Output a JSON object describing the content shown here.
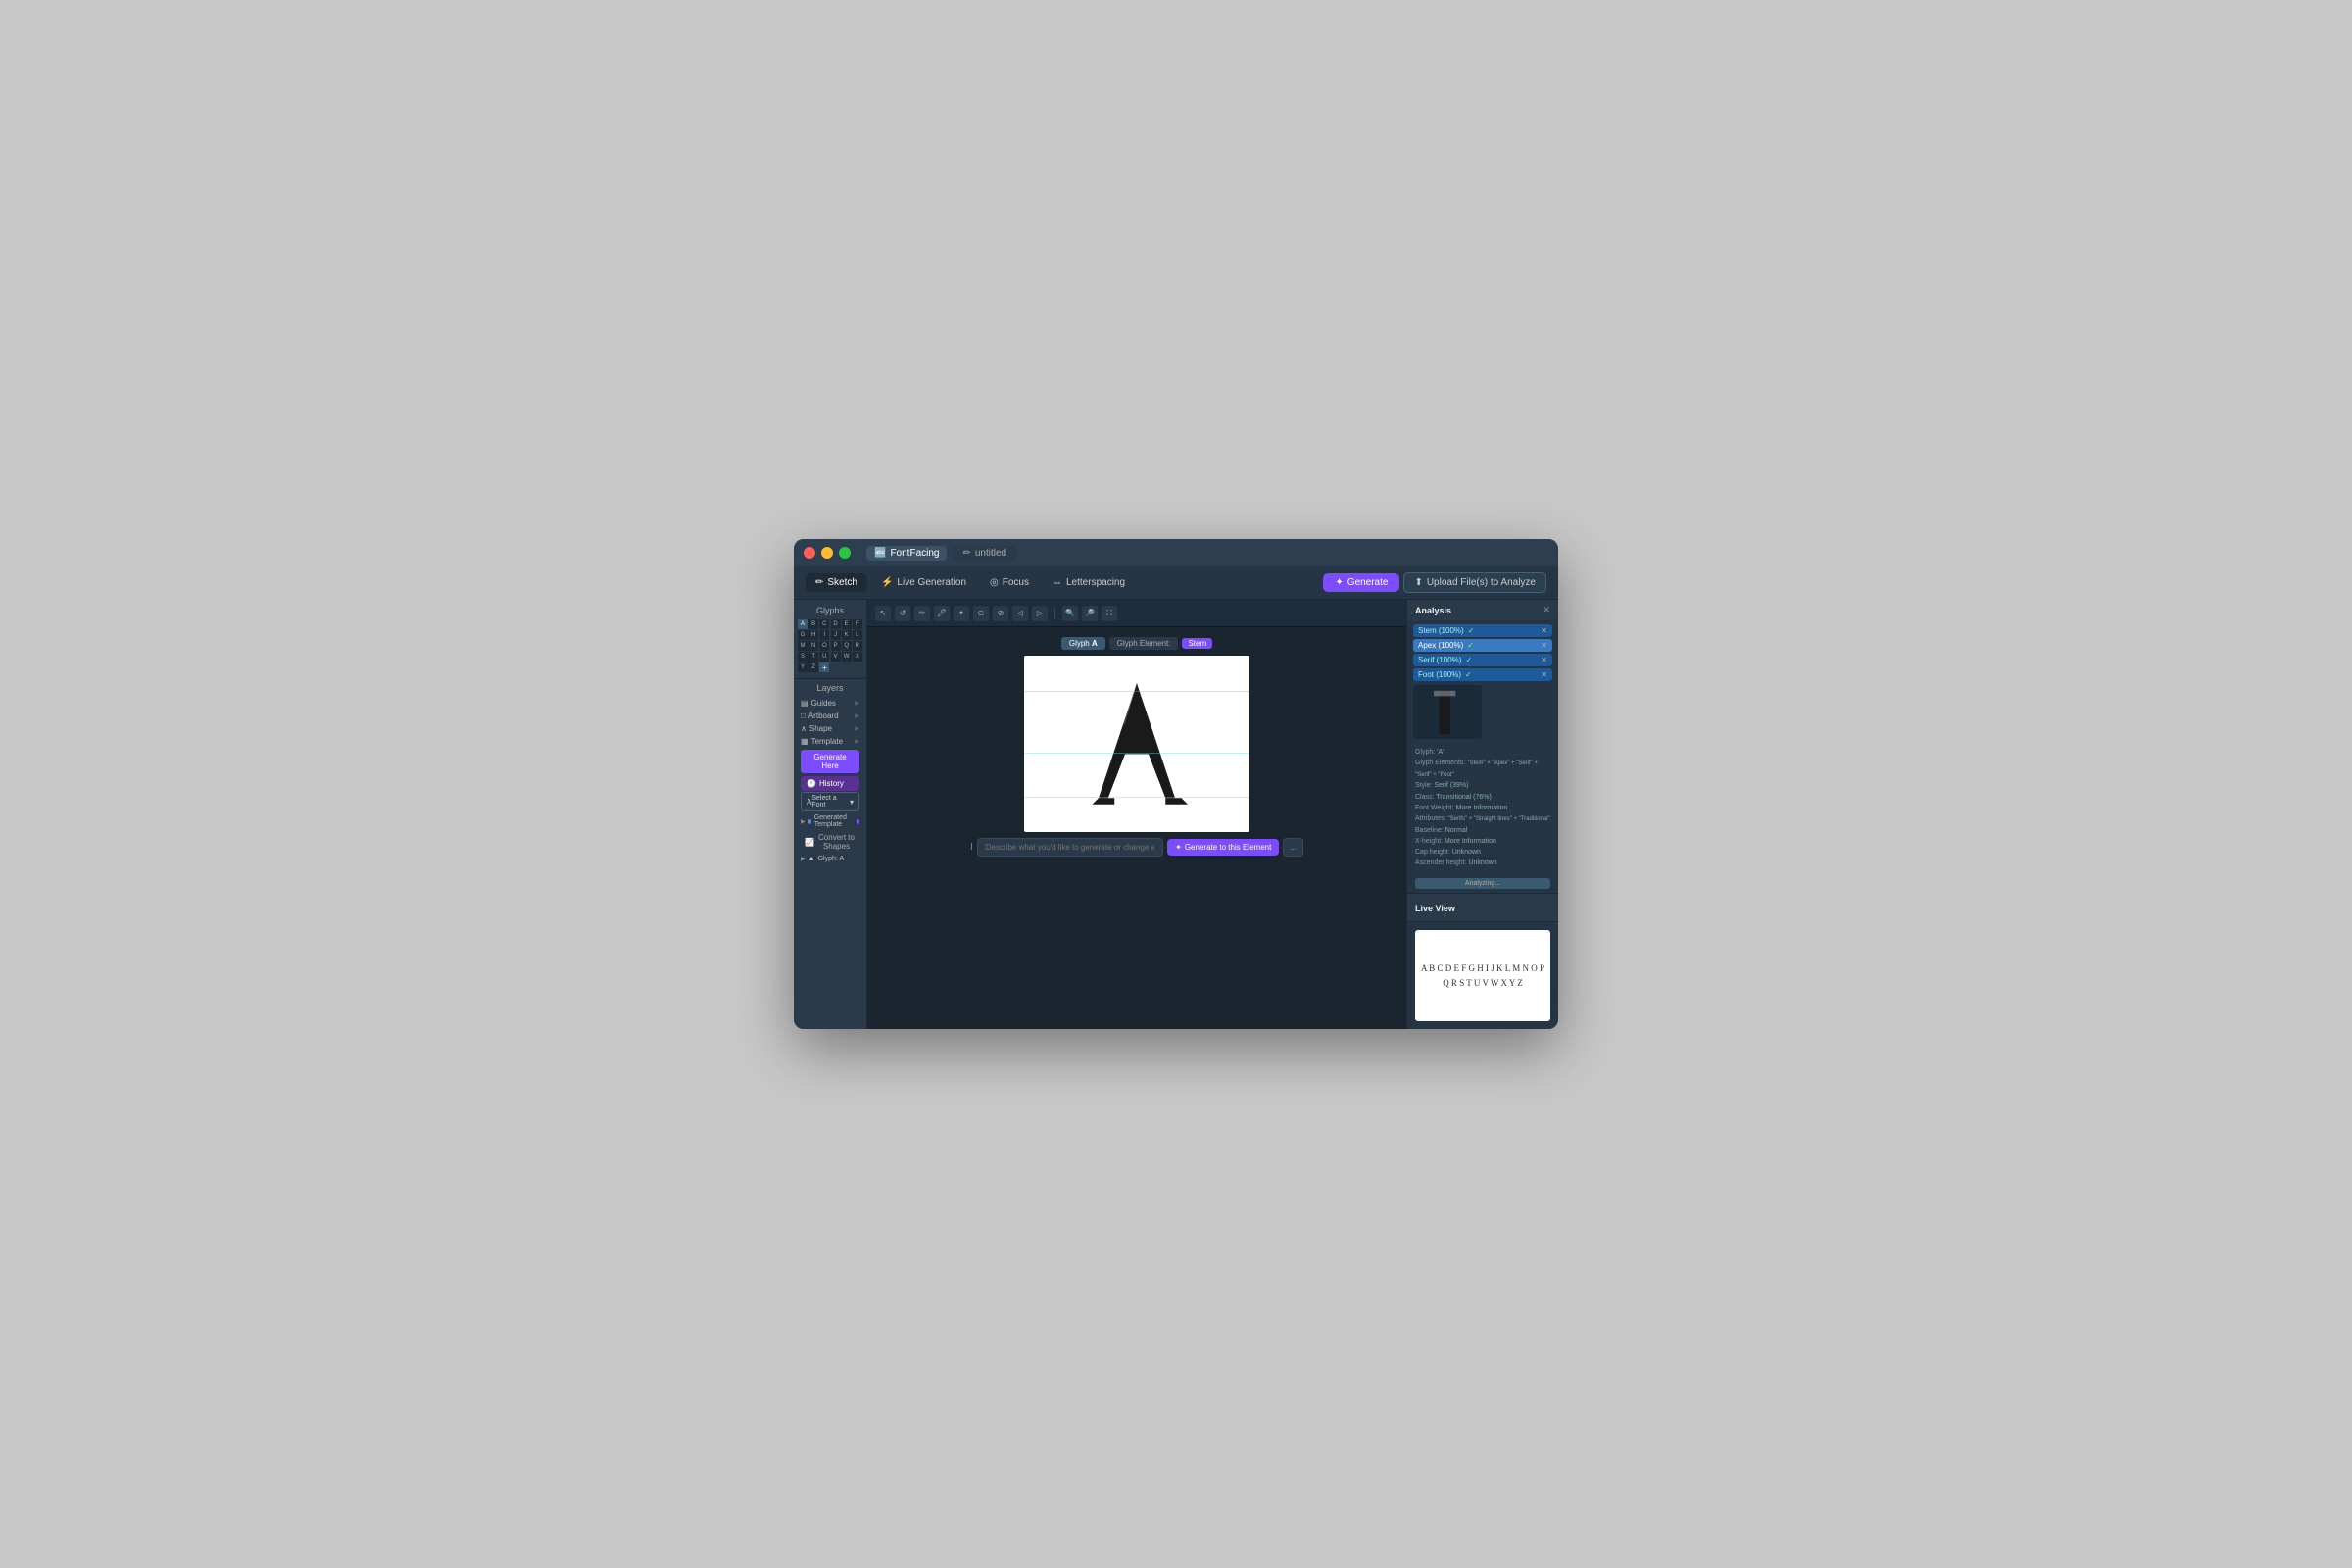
{
  "app": {
    "name": "FontFacing",
    "tab": "untitled",
    "traffic_lights": [
      "red",
      "yellow",
      "green"
    ]
  },
  "toolbar": {
    "tabs": [
      {
        "id": "sketch",
        "label": "Sketch",
        "active": true,
        "icon": "✏️"
      },
      {
        "id": "live_generation",
        "label": "Live Generation",
        "active": false,
        "icon": "⚡"
      },
      {
        "id": "focus",
        "label": "Focus",
        "active": false,
        "icon": "◎"
      },
      {
        "id": "letterspacing",
        "label": "Letterspacing",
        "active": false,
        "icon": "⇔"
      }
    ],
    "generate_label": "Generate",
    "upload_label": "Upload File(s) to Analyze"
  },
  "glyphs": {
    "title": "Glyphs",
    "letters": [
      "A",
      "B",
      "C",
      "D",
      "E",
      "F",
      "G",
      "H",
      "I",
      "J",
      "K",
      "L",
      "M",
      "N",
      "O",
      "P",
      "Q",
      "R",
      "S",
      "T",
      "U",
      "V",
      "W",
      "X",
      "Y",
      "Z"
    ],
    "active": "A"
  },
  "layers": {
    "title": "Layers",
    "items": [
      {
        "id": "guides",
        "label": "Guides",
        "icon": "▤"
      },
      {
        "id": "artboard",
        "label": "Artboard",
        "icon": "□"
      },
      {
        "id": "shape",
        "label": "Shape",
        "icon": "∧"
      },
      {
        "id": "template",
        "label": "Template",
        "icon": "▦"
      }
    ],
    "generate_here": "Generate Here",
    "history": "History",
    "select_font": "Select a Font",
    "generated_template": "Generated Template",
    "convert_to_shapes": "Convert to Shapes",
    "glyph_a": "Glyph: A"
  },
  "canvas": {
    "tools": [
      "↖",
      "↺",
      "✏",
      "🖊",
      "✦",
      "⊙",
      "⊘",
      "◁",
      "▷",
      "🔍",
      "🔍",
      "⛶"
    ],
    "glyph_tab": "Glyph: A",
    "glyph_element_tab": "Glyph Element:",
    "stem_badge": "Stem",
    "prompt_placeholder": "Describe what you'd like to generate or change about this letterform",
    "generate_to_element": "Generate to this Element",
    "more_btn": "..."
  },
  "analysis": {
    "title": "Analysis",
    "tags": [
      {
        "label": "Stem (100%)",
        "selected": false,
        "color": "blue"
      },
      {
        "label": "Apex (100%)",
        "selected": true,
        "color": "selected"
      },
      {
        "label": "Serif (100%)",
        "selected": false,
        "color": "blue"
      },
      {
        "label": "Foot (100%)",
        "selected": false,
        "color": "blue"
      }
    ],
    "glyph_label": "Glyph: 'A'",
    "elements_label": "Glyph Elements:",
    "elements_value": "\"Stem\" + \"Apex\" + \"Serif\" + \"Serif\" + \"Foot\"",
    "style_label": "Style:",
    "style_value": "Serif (39%)",
    "class_label": "Class:",
    "class_value": "Transitional (76%)",
    "weight_label": "Font Weight:",
    "weight_value": "More Information",
    "attributes_label": "Attributes:",
    "attributes_value": "\"Serifs\" + \"Straight lines\" + \"Traditional\"",
    "baseline_label": "Baseline:",
    "baseline_value": "Normal",
    "xheight_label": "X-height:",
    "xheight_value": "More Information",
    "capheight_label": "Cap height:",
    "capheight_value": "Unknown",
    "ascender_label": "Ascender height:",
    "ascender_value": "Unknown",
    "analyzing_btn": "Analyzing..."
  },
  "live_view": {
    "title": "Live View",
    "alphabet": "A B C D E F G H I J K\nL M N O P Q R S T U\nV W X Y Z"
  }
}
